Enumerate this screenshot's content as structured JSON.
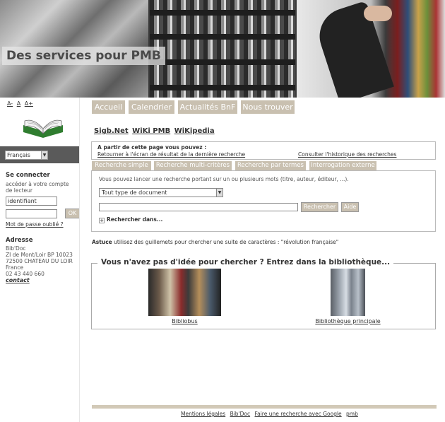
{
  "banner": {
    "title": "Des services pour PMB"
  },
  "left": {
    "font_sizes": [
      "A-",
      "A",
      "A+"
    ],
    "language": "Français",
    "connect": {
      "title": "Se connecter",
      "desc": "accéder à votre compte de lecteur",
      "login_value": "identifiant",
      "ok_label": "OK",
      "forgot": "Mot de passe oublié ?"
    },
    "address": {
      "title": "Adresse",
      "lines": [
        "Bib'Doc",
        "ZI de Mont/Loir BP 10023",
        "72500 CHATEAU DU LOIR",
        "France",
        "02 43 440 660"
      ],
      "contact": "contact"
    }
  },
  "nav": [
    "Accueil",
    "Calendrier",
    "Actualités BnF",
    "Nous trouver"
  ],
  "ext_links": [
    "Sigb.Net",
    "WiKi PMB",
    "WiKipedia"
  ],
  "info": {
    "title": "A partir de cette page vous pouvez :",
    "back": "Retourner à l'écran de résultat de la dernière recherche",
    "history": "Consulter l'historique des recherches"
  },
  "tabs": [
    "Recherche simple",
    "Recherche multi-critères",
    "Recherche par termes",
    "Interrogation externe"
  ],
  "search": {
    "help_text": "Vous pouvez lancer une recherche portant sur un ou plusieurs mots (titre, auteur, éditeur, ...).",
    "doctype": "Tout type de document",
    "search_label": "Rechercher",
    "help_label": "Aide",
    "search_in": "Rechercher dans..."
  },
  "tip": {
    "label": "Astuce",
    "text": " utilisez des guillemets pour chercher une suite de caractères : \"révolution française\""
  },
  "library": {
    "title": "Vous n'avez pas d'idée pour chercher ? Entrez dans la bibliothèque...",
    "items": [
      "Bibliobus",
      "Bibliothèque principale"
    ]
  },
  "footer": [
    "Mentions légales",
    "Bib'Doc",
    "Faire une recherche avec Google",
    "pmb"
  ]
}
